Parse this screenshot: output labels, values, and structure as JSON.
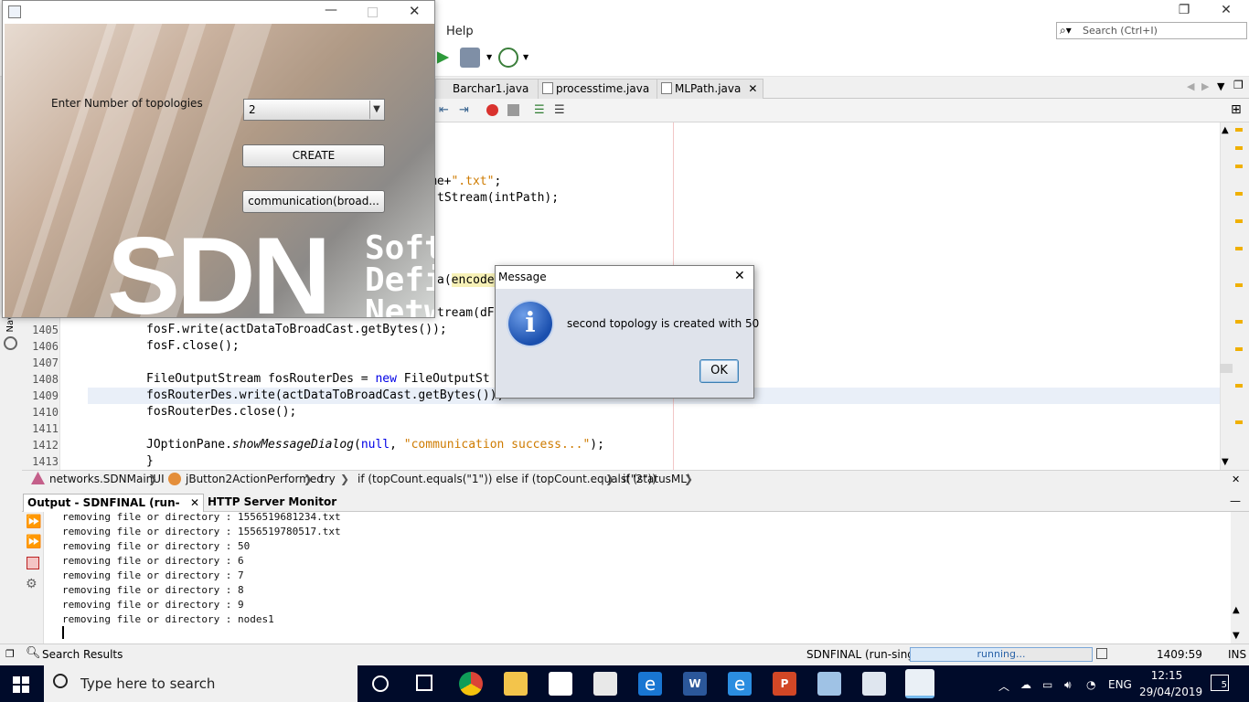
{
  "ide": {
    "menu_help": "Help",
    "search_placeholder": "Search (Ctrl+I)",
    "editor_tabs": [
      {
        "label": "Barchar1.java"
      },
      {
        "label": "processtime.java"
      },
      {
        "label": "MLPath.java"
      }
    ],
    "code": {
      "partial_1": "me+\".txt\";",
      "partial_1_a": "me+",
      "partial_1_b": "\".txt\"",
      "partial_1_c": ";",
      "partial_2": "tStream(intPath);",
      "partial_3a": "a(",
      "partial_3b": "encode",
      "partial_4": "tream(dFi",
      "lines": [
        {
          "num": "1405",
          "text": "fosF.write(actDataToBroadCast.getBytes());"
        },
        {
          "num": "1406",
          "text": "fosF.close();"
        },
        {
          "num": "1407",
          "text": ""
        },
        {
          "num": "1408",
          "text_a": "FileOutputStream fosRouterDes = ",
          "kw": "new",
          "text_b": " FileOutputSt"
        },
        {
          "num": "1409",
          "text": "fosRouterDes.write(actDataToBroadCast.getBytes());"
        },
        {
          "num": "1410",
          "text": "fosRouterDes.close();"
        },
        {
          "num": "1411",
          "text": ""
        },
        {
          "num": "1412",
          "text_a": "JOptionPane.",
          "it": "showMessageDialog",
          "text_b": "(",
          "kw": "null",
          "text_c": ", ",
          "str": "\"communication success...\"",
          "text_d": ");"
        },
        {
          "num": "1413",
          "text": "}"
        }
      ]
    },
    "breadcrumb": [
      "networks.SDNMainUI",
      "jButton2ActionPerformed",
      "try",
      "if (topCount.equals(\"1\")) else if (topCount.equals(\"2\"))",
      "if (statusML)"
    ],
    "output": {
      "tab_active": "Output - SDNFINAL (run-single)",
      "tab_2": "HTTP Server Monitor",
      "lines": [
        "removing file or directory : 1556519681234.txt",
        "removing file or directory : 1556519780517.txt",
        "removing file or directory : 50",
        "removing file or directory : 6",
        "removing file or directory : 7",
        "removing file or directory : 8",
        "removing file or directory : 9",
        "removing file or directory : nodes1"
      ]
    },
    "status": {
      "search_results": "Search Results",
      "project": "SDNFINAL (run-single)",
      "progress_text": "running...",
      "progress_fraction": 0.5,
      "position": "1409:59",
      "mode": "INS"
    }
  },
  "sdn_app": {
    "label": "Enter Number of topologies",
    "select_value": "2",
    "create_button": "CREATE",
    "communication_button": "communication(broad...",
    "banner_big": "SDN",
    "banner_words": [
      "Soft",
      "Defi",
      "Netw"
    ]
  },
  "dialog": {
    "title": "Message",
    "message": "second topology is created with 50",
    "ok": "OK"
  },
  "taskbar": {
    "search_placeholder": "Type here to search",
    "lang": "ENG",
    "time": "12:15",
    "date": "29/04/2019",
    "notifications": "5"
  },
  "colors": {
    "taskbar": "#000b2a",
    "dialog_bg": "#dfe3eb",
    "keyword": "#0000e6",
    "string": "#ce7b00"
  }
}
